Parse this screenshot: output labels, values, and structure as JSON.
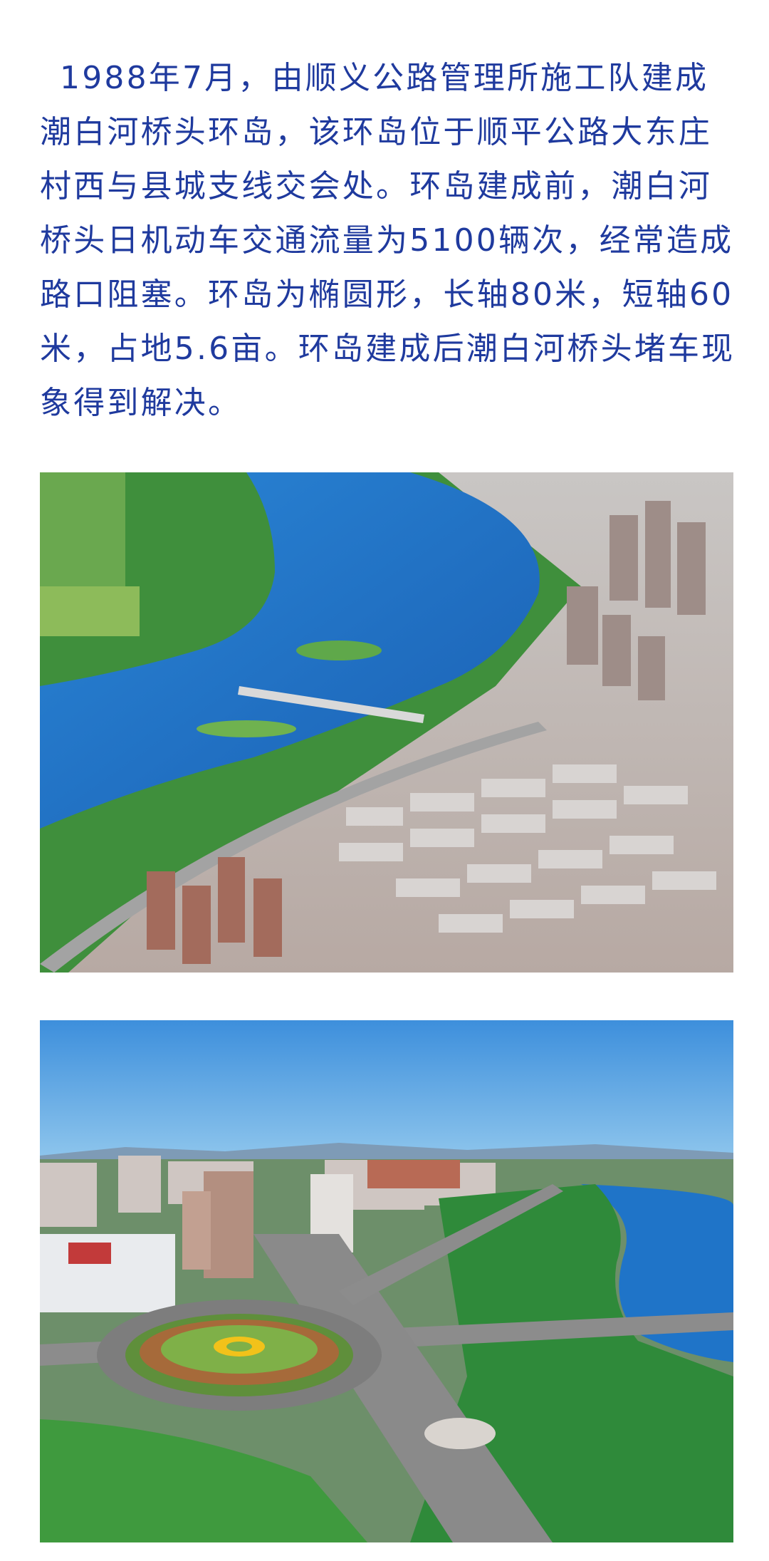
{
  "article": {
    "paragraph": "1988年7月，由顺义公路管理所施工队建成潮白河桥头环岛，该环岛位于顺平公路大东庄村西与县城支线交会处。环岛建成前，潮白河桥头日机动车交通流量为5100辆次，经常造成路口阻塞。环岛为椭圆形，长轴80米，短轴60米，占地5.6亩。环岛建成后潮白河桥头堵车现象得到解决。"
  },
  "colors": {
    "text": "#1f3a9e",
    "water": "#1f74c8",
    "sky": "#3f9be0",
    "vegetation": "#2f8a3a"
  }
}
